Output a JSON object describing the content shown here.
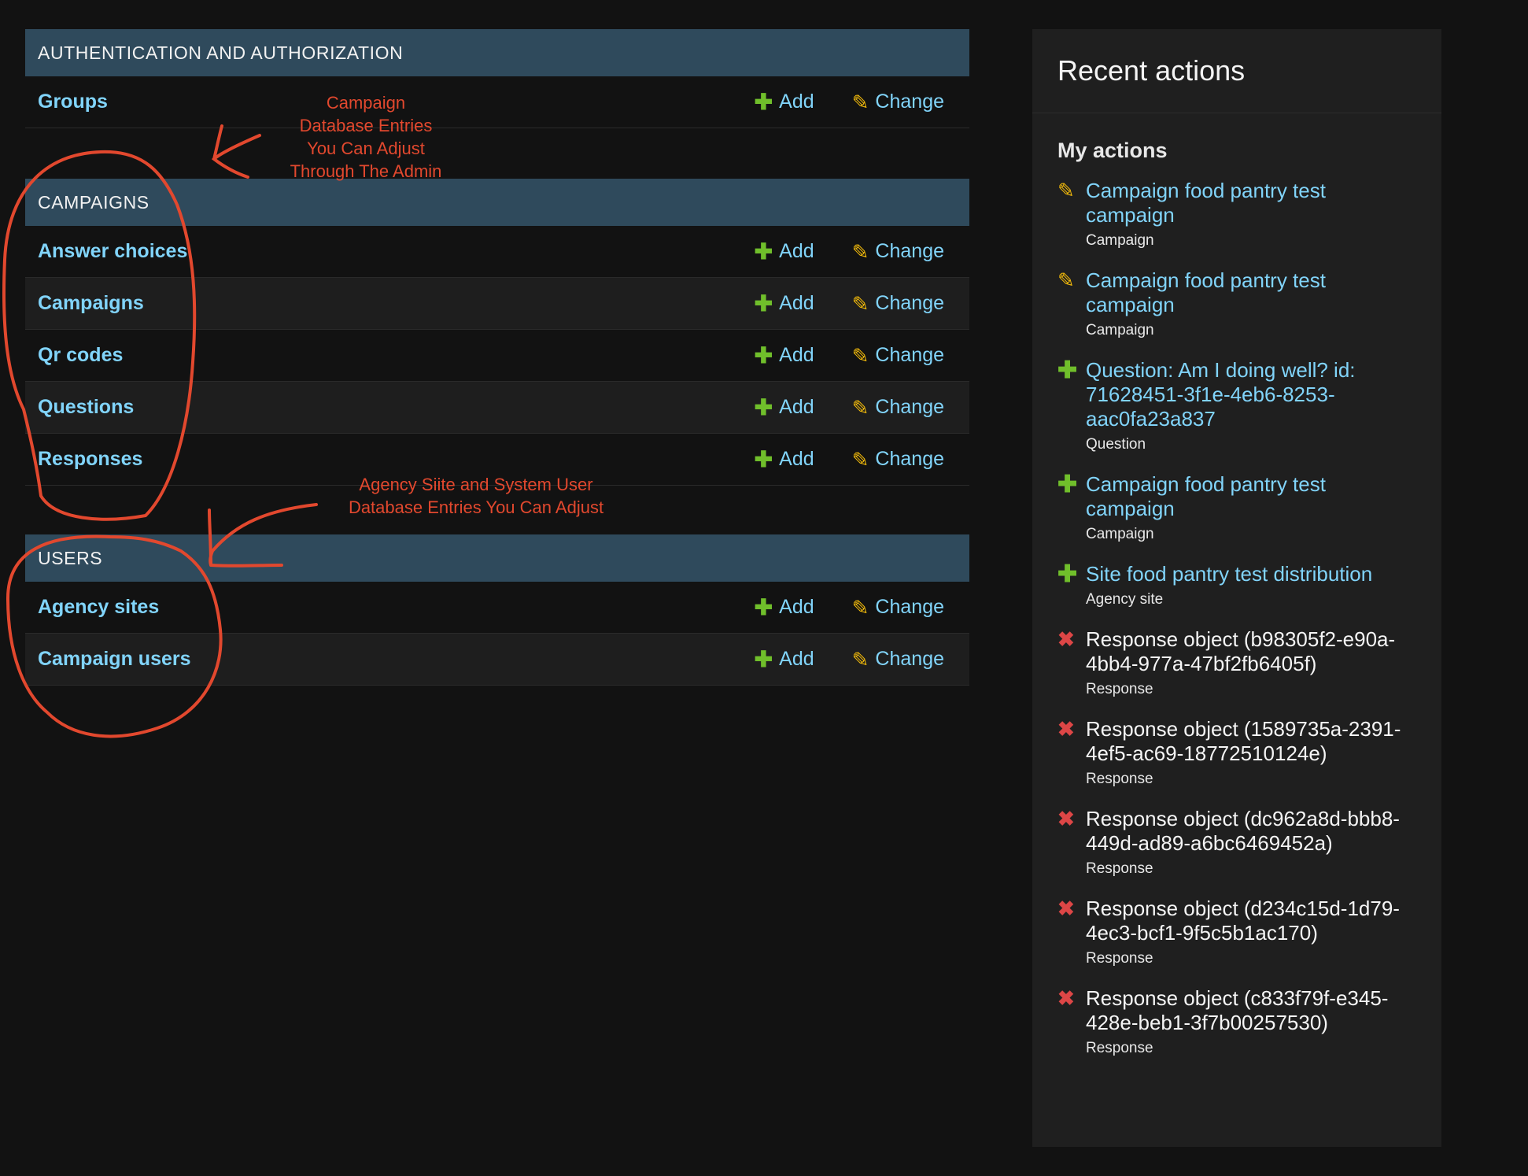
{
  "modules": [
    {
      "title": "AUTHENTICATION AND AUTHORIZATION",
      "models": [
        {
          "name": "Groups",
          "add": "Add",
          "change": "Change"
        }
      ]
    },
    {
      "title": "CAMPAIGNS",
      "models": [
        {
          "name": "Answer choices",
          "add": "Add",
          "change": "Change"
        },
        {
          "name": "Campaigns",
          "add": "Add",
          "change": "Change"
        },
        {
          "name": "Qr codes",
          "add": "Add",
          "change": "Change"
        },
        {
          "name": "Questions",
          "add": "Add",
          "change": "Change"
        },
        {
          "name": "Responses",
          "add": "Add",
          "change": "Change"
        }
      ]
    },
    {
      "title": "USERS",
      "models": [
        {
          "name": "Agency sites",
          "add": "Add",
          "change": "Change"
        },
        {
          "name": "Campaign users",
          "add": "Add",
          "change": "Change"
        }
      ]
    }
  ],
  "annotations": {
    "campaigns": [
      "Campaign",
      "Database Entries",
      "You Can Adjust",
      "Through The Admin"
    ],
    "users": [
      "Agency Siite and System User",
      "Database Entries You Can Adjust"
    ]
  },
  "sidebar": {
    "title": "Recent actions",
    "subtitle": "My actions",
    "actions": [
      {
        "kind": "change",
        "icon": "pencil-icon",
        "text": "Campaign food pantry test campaign",
        "type": "Campaign"
      },
      {
        "kind": "change",
        "icon": "pencil-icon",
        "text": "Campaign food pantry test campaign",
        "type": "Campaign"
      },
      {
        "kind": "add",
        "icon": "plus-icon",
        "text": "Question: Am I doing well? id: 71628451-3f1e-4eb6-8253-aac0fa23a837",
        "type": "Question"
      },
      {
        "kind": "add",
        "icon": "plus-icon",
        "text": "Campaign food pantry test campaign",
        "type": "Campaign"
      },
      {
        "kind": "add",
        "icon": "plus-icon",
        "text": "Site food pantry test distribution",
        "type": "Agency site"
      },
      {
        "kind": "delete",
        "icon": "x-icon",
        "text": "Response object (b98305f2-e90a-4bb4-977a-47bf2fb6405f)",
        "type": "Response"
      },
      {
        "kind": "delete",
        "icon": "x-icon",
        "text": "Response object (1589735a-2391-4ef5-ac69-18772510124e)",
        "type": "Response"
      },
      {
        "kind": "delete",
        "icon": "x-icon",
        "text": "Response object (dc962a8d-bbb8-449d-ad89-a6bc6469452a)",
        "type": "Response"
      },
      {
        "kind": "delete",
        "icon": "x-icon",
        "text": "Response object (d234c15d-1d79-4ec3-bcf1-9f5c5b1ac170)",
        "type": "Response"
      },
      {
        "kind": "delete",
        "icon": "x-icon",
        "text": "Response object (c833f79f-e345-428e-beb1-3f7b00257530)",
        "type": "Response"
      }
    ]
  },
  "colors": {
    "module_header": "#2f4a5c",
    "link": "#81d4fa",
    "add_icon": "#70bf2b",
    "change_icon": "#efb80b",
    "delete_icon": "#dd4646",
    "annotation": "#e2482e"
  }
}
